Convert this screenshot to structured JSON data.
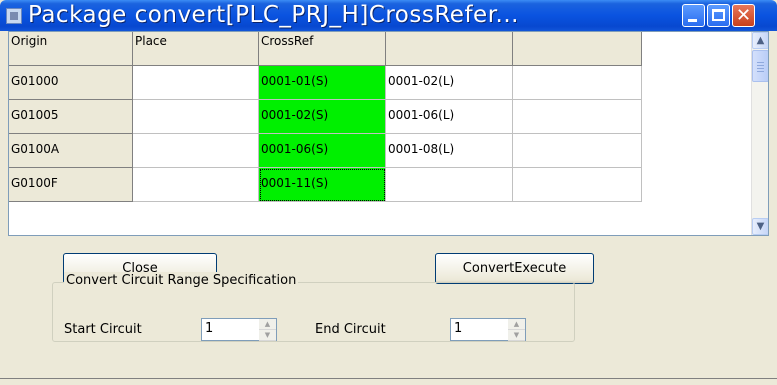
{
  "window": {
    "title": "Package convert[PLC_PRJ_H]CrossRefer..."
  },
  "grid": {
    "columns": [
      "Origin",
      "Place",
      "CrossRef",
      "",
      ""
    ],
    "rows": [
      {
        "origin": "G01000",
        "place": "",
        "crossref": "0001-01(S)",
        "col4": "0001-02(L)",
        "col5": ""
      },
      {
        "origin": "G01005",
        "place": "",
        "crossref": "0001-02(S)",
        "col4": "0001-06(L)",
        "col5": ""
      },
      {
        "origin": "G0100A",
        "place": "",
        "crossref": "0001-06(S)",
        "col4": "0001-08(L)",
        "col5": ""
      },
      {
        "origin": "G0100F",
        "place": "",
        "crossref": "0001-11(S)",
        "col4": "",
        "col5": ""
      }
    ]
  },
  "buttons": {
    "close": "Close",
    "convert_execute": "ConvertExecute"
  },
  "range": {
    "legend": "Convert Circuit Range Specification",
    "start_label": "Start Circuit",
    "start_value": "1",
    "end_label": "End Circuit",
    "end_value": "1"
  },
  "colors": {
    "titlebar": "#0a53e0",
    "crossref_highlight": "#00f000"
  },
  "icons": [
    "app-icon",
    "minimize-icon",
    "maximize-icon",
    "close-icon",
    "scroll-up-icon",
    "scroll-down-icon",
    "spin-up-icon",
    "spin-down-icon"
  ]
}
